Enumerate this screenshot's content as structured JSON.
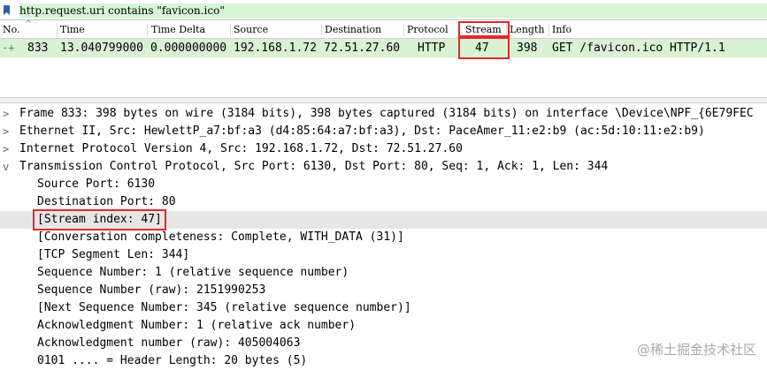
{
  "filter": {
    "text": "http.request.uri contains \"favicon.ico\""
  },
  "columns": [
    "No.",
    "Time",
    "Time Delta",
    "Source",
    "Destination",
    "Protocol",
    "Stream",
    "Length",
    "Info"
  ],
  "packet": {
    "no": "833",
    "time": "13.040799000",
    "delta": "0.000000000",
    "source": "192.168.1.72",
    "destination": "72.51.27.60",
    "protocol": "HTTP",
    "stream": "47",
    "length": "398",
    "info": "GET /favicon.ico HTTP/1.1"
  },
  "details": {
    "top": [
      {
        "toggle": ">",
        "text": "Frame 833: 398 bytes on wire (3184 bits), 398 bytes captured (3184 bits) on interface \\Device\\NPF_{6E79FEC"
      },
      {
        "toggle": ">",
        "text": "Ethernet II, Src: HewlettP_a7:bf:a3 (d4:85:64:a7:bf:a3), Dst: PaceAmer_11:e2:b9 (ac:5d:10:11:e2:b9)"
      },
      {
        "toggle": ">",
        "text": "Internet Protocol Version 4, Src: 192.168.1.72, Dst: 72.51.27.60"
      },
      {
        "toggle": "v",
        "text": "Transmission Control Protocol, Src Port: 6130, Dst Port: 80, Seq: 1, Ack: 1, Len: 344"
      }
    ],
    "tcp": [
      "Source Port: 6130",
      "Destination Port: 80",
      "[Stream index: 47]",
      "[Conversation completeness: Complete, WITH_DATA (31)]",
      "[TCP Segment Len: 344]",
      "Sequence Number: 1    (relative sequence number)",
      "Sequence Number (raw): 2151990253",
      "[Next Sequence Number: 345    (relative sequence number)]",
      "Acknowledgment Number: 1    (relative ack number)",
      "Acknowledgment number (raw): 405004063",
      "0101 .... = Header Length: 20 bytes (5)"
    ]
  },
  "watermark": {
    "text": "@稀土掘金技术社区"
  },
  "colors": {
    "row": "#d8f2d3",
    "filter": "#d6f5d6",
    "highlight": "#e8262a",
    "selected": "#e6e6e6"
  },
  "icons": {
    "filter": "bookmark-icon",
    "expand": "chevron-right-icon",
    "collapse": "chevron-down-icon",
    "related": "packet-arrow-icon"
  }
}
